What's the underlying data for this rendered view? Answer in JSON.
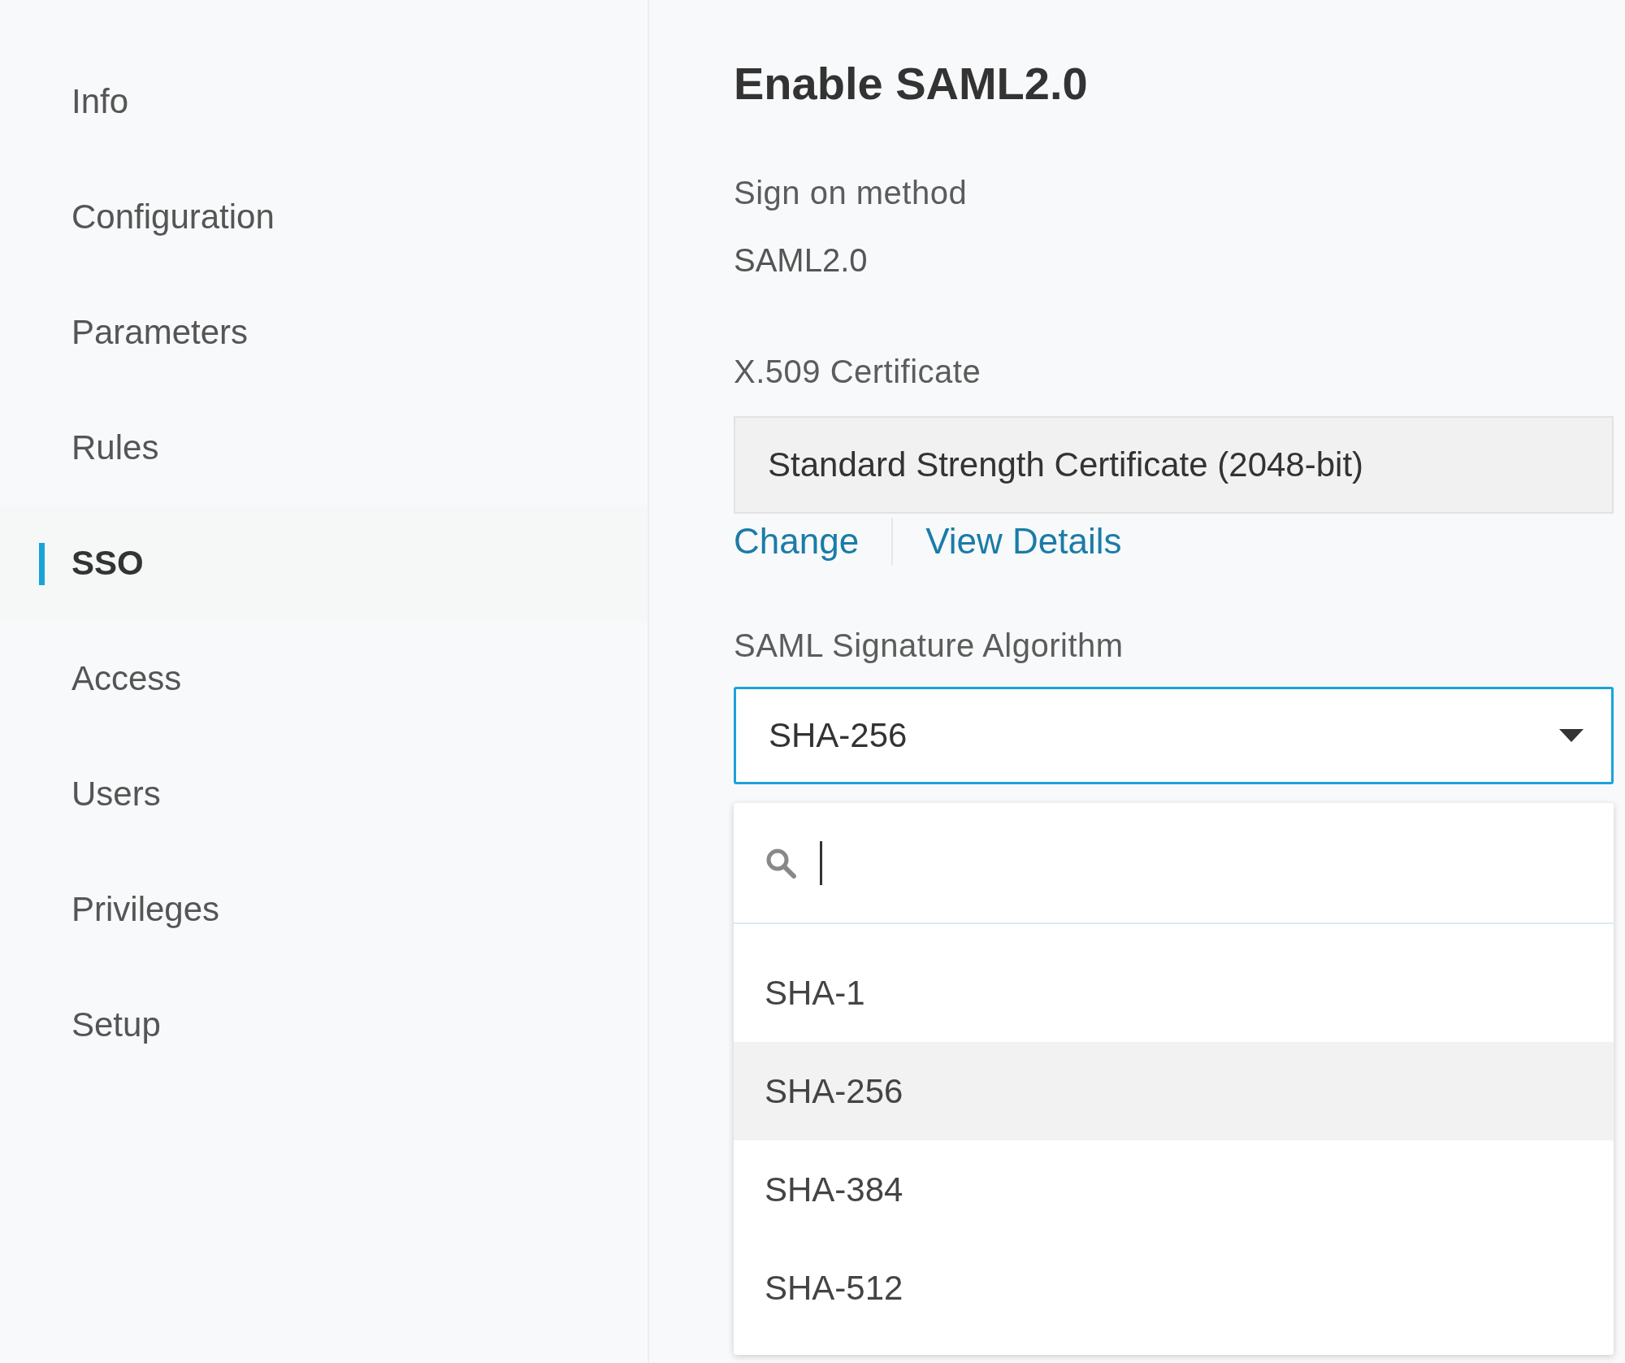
{
  "sidebar": {
    "items": [
      {
        "label": "Info",
        "selected": false
      },
      {
        "label": "Configuration",
        "selected": false
      },
      {
        "label": "Parameters",
        "selected": false
      },
      {
        "label": "Rules",
        "selected": false
      },
      {
        "label": "SSO",
        "selected": true
      },
      {
        "label": "Access",
        "selected": false
      },
      {
        "label": "Users",
        "selected": false
      },
      {
        "label": "Privileges",
        "selected": false
      },
      {
        "label": "Setup",
        "selected": false
      }
    ]
  },
  "main": {
    "title": "Enable SAML2.0",
    "sign_on_method": {
      "label": "Sign on method",
      "value": "SAML2.0"
    },
    "certificate": {
      "label": "X.509 Certificate",
      "value": "Standard Strength Certificate (2048-bit)",
      "links": [
        "Change",
        "View Details"
      ]
    },
    "signature_algorithm": {
      "label": "SAML Signature Algorithm",
      "value": "SHA-256",
      "expanded": true,
      "options": [
        {
          "label": "SHA-1",
          "selected": false
        },
        {
          "label": "SHA-256",
          "selected": true
        },
        {
          "label": "SHA-384",
          "selected": false
        },
        {
          "label": "SHA-512",
          "selected": false
        }
      ]
    }
  }
}
